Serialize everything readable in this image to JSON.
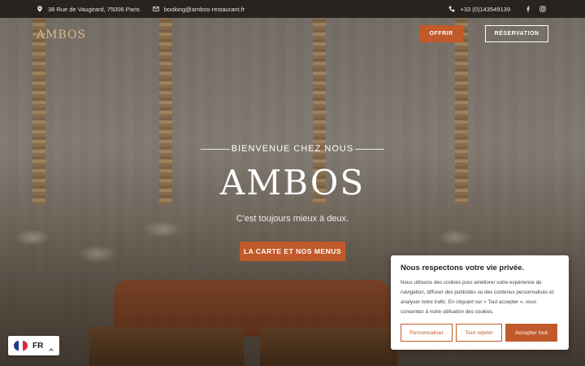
{
  "topbar": {
    "address": "38 Rue de Vaugirard, 75006 Paris",
    "email": "booking@ambos-restaurant.fr",
    "phone": "+33 (0)143549139",
    "icons": [
      "map-pin-icon",
      "envelope-icon",
      "phone-icon",
      "facebook-icon",
      "instagram-icon"
    ]
  },
  "nav": {
    "logo": "AMBOS",
    "offrir_label": "OFFRIR",
    "reservation_label": "RÉSERVATION"
  },
  "hero": {
    "welcome": "BIENVENUE CHEZ NOUS",
    "title": "AMBOS",
    "subtitle": "C'est toujours mieux à deux.",
    "cta_label": "LA CARTE ET NOS MENUS"
  },
  "cookie": {
    "title": "Nous respectons votre vie privée.",
    "body": "Nous utilisons des cookies pour améliorer votre expérience de navigation, diffuser des publicités ou des contenus personnalisés et analyser notre trafic. En cliquant sur « Tout accepter », vous consentez à notre utilisation des cookies.",
    "customize_label": "Personnaliser",
    "reject_label": "Tout rejeter",
    "accept_label": "Accepter tout"
  },
  "language": {
    "code": "FR",
    "flag": "france-flag-icon"
  },
  "colors": {
    "accent": "#c15a2a",
    "logo": "#d9b98a",
    "topbar_bg": "#262320"
  }
}
